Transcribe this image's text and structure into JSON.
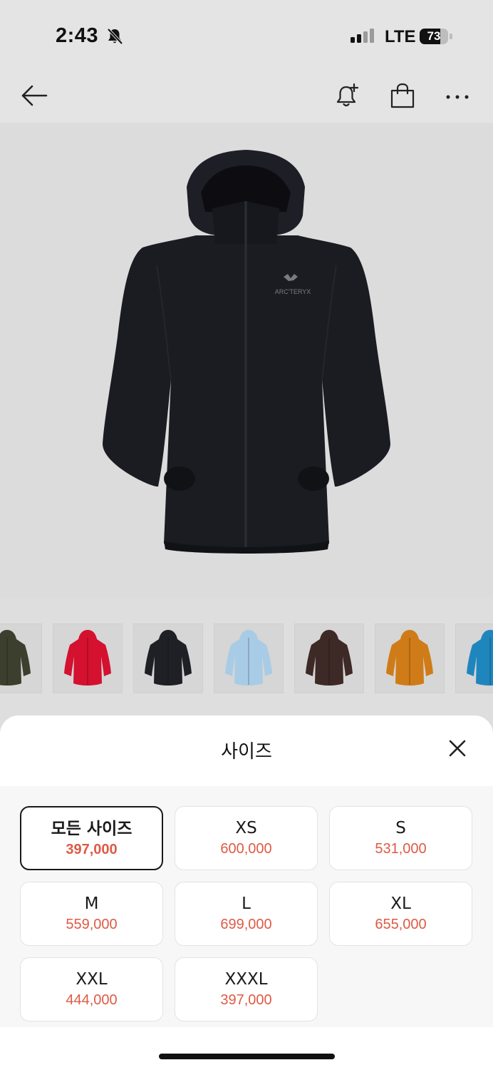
{
  "status_bar": {
    "time": "2:43",
    "network": "LTE",
    "battery": "73",
    "battery_level": 0.73
  },
  "nav": {
    "back_icon": "arrow-left-icon",
    "alert_icon": "bell-plus-icon",
    "bag_icon": "shopping-bag-icon",
    "more_icon": "more-horizontal-icon"
  },
  "product": {
    "brand_mark": "ARC'TERYX"
  },
  "thumbnails": [
    {
      "color": "#3c3f2e"
    },
    {
      "color": "#d4112f"
    },
    {
      "color": "#1f2026"
    },
    {
      "color": "#a9cce6"
    },
    {
      "color": "#3d2a26"
    },
    {
      "color": "#cf7c18"
    },
    {
      "color": "#1f86bd"
    }
  ],
  "sheet": {
    "title": "사이즈",
    "close_icon": "close-icon"
  },
  "sizes": [
    {
      "label": "모든 사이즈",
      "price": "397,000",
      "selected": true
    },
    {
      "label": "XS",
      "price": "600,000",
      "selected": false
    },
    {
      "label": "S",
      "price": "531,000",
      "selected": false
    },
    {
      "label": "M",
      "price": "559,000",
      "selected": false
    },
    {
      "label": "L",
      "price": "699,000",
      "selected": false
    },
    {
      "label": "XL",
      "price": "655,000",
      "selected": false
    },
    {
      "label": "XXL",
      "price": "444,000",
      "selected": false
    },
    {
      "label": "XXXL",
      "price": "397,000",
      "selected": false
    }
  ],
  "colors": {
    "price_accent": "#de5a45",
    "selected_border": "#1a1a1a"
  }
}
